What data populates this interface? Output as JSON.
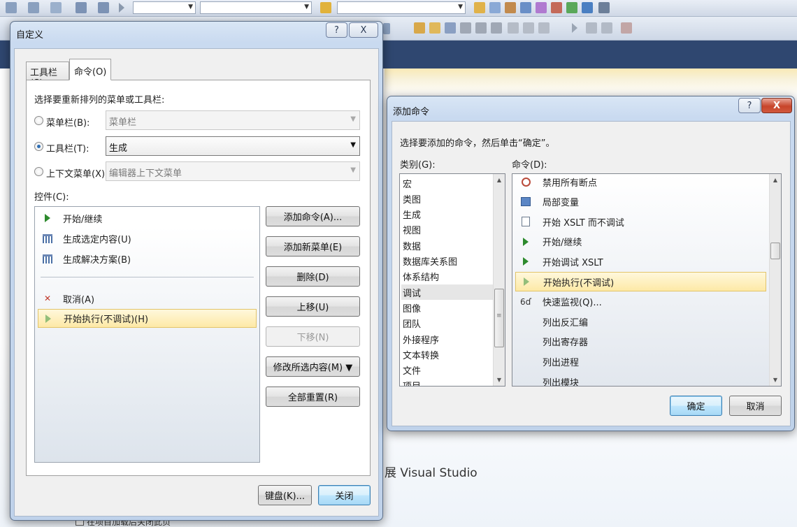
{
  "ide": {
    "background_text": "展 Visual Studio",
    "checkbox_label": "在项目加载后关闭此页"
  },
  "customize_dialog": {
    "title": "自定义",
    "help_glyph": "?",
    "close_glyph": "X",
    "tabs": [
      {
        "label": "工具栏(S)",
        "active": false
      },
      {
        "label": "命令(O)",
        "active": true
      }
    ],
    "instruction": "选择要重新排列的菜单或工具栏:",
    "menubar": {
      "label": "菜单栏(B):",
      "value": "菜单栏",
      "selected": false,
      "enabled": false
    },
    "toolbar": {
      "label": "工具栏(T):",
      "value": "生成",
      "selected": true,
      "enabled": true
    },
    "context_menu": {
      "label": "上下文菜单(X):",
      "value": "编辑器上下文菜单",
      "selected": false,
      "enabled": false
    },
    "controls_label": "控件(C):",
    "controls": [
      {
        "label": "开始/继续",
        "icon": "play-icon"
      },
      {
        "label": "生成选定内容(U)",
        "icon": "build-selection-icon"
      },
      {
        "label": "生成解决方案(B)",
        "icon": "build-solution-icon"
      },
      {
        "label": "取消(A)",
        "icon": "cancel-build-icon"
      },
      {
        "label": "开始执行(不调试)(H)",
        "icon": "start-without-debug-icon",
        "selected": true
      }
    ],
    "buttons": {
      "add_command": "添加命令(A)...",
      "add_menu": "添加新菜单(E)",
      "delete": "删除(D)",
      "move_up": "上移(U)",
      "move_down": "下移(N)",
      "modify_selection": "修改所选内容(M) ▼",
      "reset_all": "全部重置(R)",
      "keyboard": "键盘(K)...",
      "close": "关闭"
    }
  },
  "add_command_dialog": {
    "title": "添加命令",
    "help_glyph": "?",
    "close_glyph": "X",
    "instruction": "选择要添加的命令，然后单击“确定”。",
    "categories_label": "类别(G):",
    "commands_label": "命令(D):",
    "categories": [
      "宏",
      "类图",
      "生成",
      "视图",
      "数据",
      "数据库关系图",
      "体系结构",
      "调试",
      "图像",
      "团队",
      "外接程序",
      "文本转换",
      "文件",
      "项目"
    ],
    "selected_category": "调试",
    "commands": [
      {
        "label": "禁用所有断点",
        "icon": "disable-breakpoints-icon"
      },
      {
        "label": "局部变量",
        "icon": "locals-icon"
      },
      {
        "label": "开始 XSLT 而不调试",
        "icon": "xslt-no-debug-icon"
      },
      {
        "label": "开始/继续",
        "icon": "play-icon"
      },
      {
        "label": "开始调试 XSLT",
        "icon": "xslt-debug-icon"
      },
      {
        "label": "开始执行(不调试)",
        "icon": "start-without-debug-icon",
        "selected": true
      },
      {
        "label": "快速监视(Q)...",
        "icon": "quickwatch-icon"
      },
      {
        "label": "列出反汇编",
        "icon": ""
      },
      {
        "label": "列出寄存器",
        "icon": ""
      },
      {
        "label": "列出进程",
        "icon": ""
      },
      {
        "label": "列出模块",
        "icon": ""
      }
    ],
    "buttons": {
      "ok": "确定",
      "cancel": "取消"
    }
  }
}
